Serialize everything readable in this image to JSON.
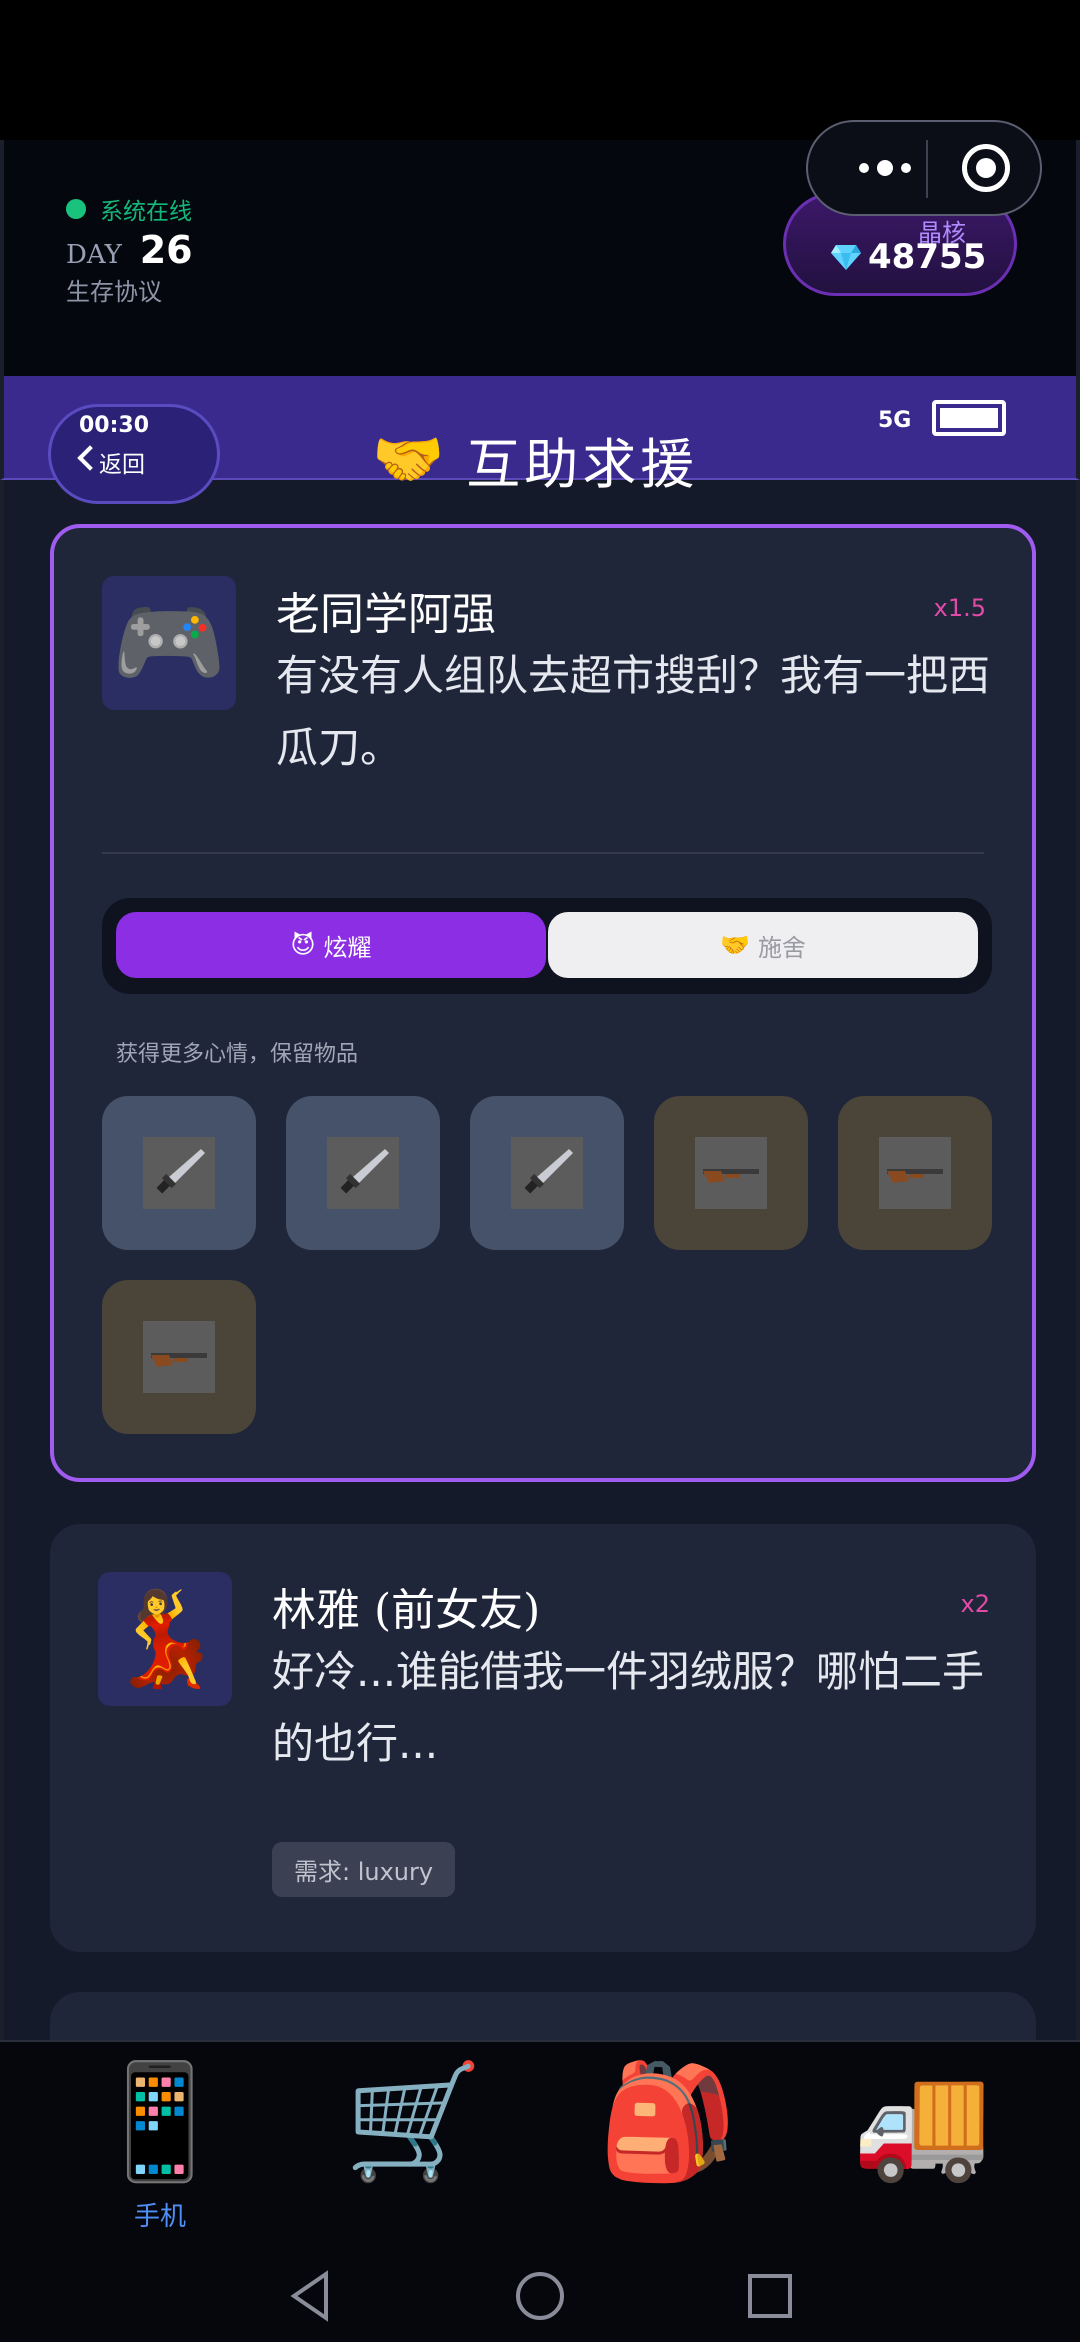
{
  "system": {
    "online_text": "系统在线",
    "day_label": "DAY",
    "day_number": "26",
    "protocol": "生存协议"
  },
  "crystal": {
    "name": "晶核",
    "value": "48755"
  },
  "titlebar": {
    "time": "00:30",
    "back_label": "返回",
    "title_icon": "🤝",
    "title": "互助求援",
    "signal": "5G"
  },
  "requests": [
    {
      "avatar": "🎮",
      "name": "老同学阿强",
      "multiplier": "x1.5",
      "message": "有没有人组队去超市搜刮？我有一把西瓜刀。",
      "toggle": {
        "show_off_icon": "😈",
        "show_off": "炫耀",
        "give_icon": "🤝",
        "give": "施舍"
      },
      "hint": "获得更多心情，保留物品",
      "items": [
        {
          "type": "knife"
        },
        {
          "type": "knife"
        },
        {
          "type": "knife"
        },
        {
          "type": "rifle"
        },
        {
          "type": "rifle"
        },
        {
          "type": "rifle"
        }
      ]
    },
    {
      "avatar": "💃",
      "name": "林雅 (前女友)",
      "multiplier": "x2",
      "message": "好冷...谁能借我一件羽绒服？哪怕二手的也行...",
      "need": "需求: luxury"
    }
  ],
  "nav": {
    "items": [
      {
        "icon": "📱",
        "label": "手机",
        "active": true
      },
      {
        "icon": "🛒",
        "label": ""
      },
      {
        "icon": "🎒",
        "label": ""
      },
      {
        "icon": "🚚",
        "label": ""
      }
    ]
  },
  "colors": {
    "accent": "#8b2ee4",
    "nav_active": "#4e8ff8",
    "online": "#19c37d"
  }
}
